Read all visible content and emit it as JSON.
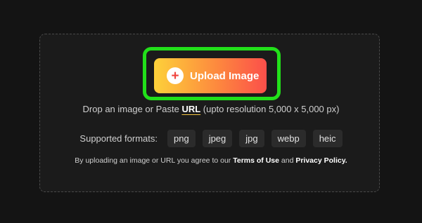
{
  "upload": {
    "button_label": "Upload Image",
    "plus_glyph": "+",
    "icon": "plus-circle-icon"
  },
  "drop": {
    "prefix": "Drop an image or Paste ",
    "url_link": "URL",
    "suffix": " (upto resolution 5,000 x 5,000 px)"
  },
  "formats": {
    "label": "Supported formats:",
    "items": [
      "png",
      "jpeg",
      "jpg",
      "webp",
      "heic"
    ]
  },
  "terms": {
    "prefix": "By uploading an image or URL you agree to our ",
    "terms_link": "Terms of Use",
    "middle": " and ",
    "privacy_link": "Privacy Policy."
  },
  "colors": {
    "background": "#141414",
    "highlight": "#22e01a",
    "gradient_start": "#fdd13a",
    "gradient_end": "#fb4f4a"
  }
}
